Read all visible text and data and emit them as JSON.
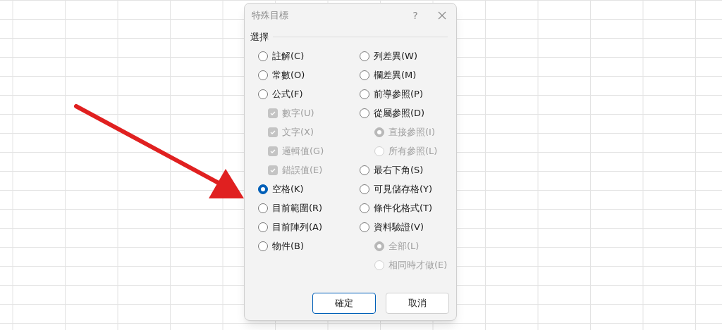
{
  "dialog": {
    "title": "特殊目標",
    "help": "?",
    "group_label": "選擇",
    "columns": [
      [
        {
          "kind": "radio",
          "label": "註解(C)",
          "selected": false,
          "disabled": false
        },
        {
          "kind": "radio",
          "label": "常數(O)",
          "selected": false,
          "disabled": false
        },
        {
          "kind": "radio",
          "label": "公式(F)",
          "selected": false,
          "disabled": false,
          "children": [
            {
              "kind": "checkbox",
              "label": "數字(U)",
              "checked": true,
              "disabled": true
            },
            {
              "kind": "checkbox",
              "label": "文字(X)",
              "checked": true,
              "disabled": true
            },
            {
              "kind": "checkbox",
              "label": "邏輯值(G)",
              "checked": true,
              "disabled": true
            },
            {
              "kind": "checkbox",
              "label": "錯誤值(E)",
              "checked": true,
              "disabled": true
            }
          ]
        },
        {
          "kind": "radio",
          "label": "空格(K)",
          "selected": true,
          "disabled": false
        },
        {
          "kind": "radio",
          "label": "目前範圍(R)",
          "selected": false,
          "disabled": false
        },
        {
          "kind": "radio",
          "label": "目前陣列(A)",
          "selected": false,
          "disabled": false
        },
        {
          "kind": "radio",
          "label": "物件(B)",
          "selected": false,
          "disabled": false
        }
      ],
      [
        {
          "kind": "radio",
          "label": "列差異(W)",
          "selected": false,
          "disabled": false
        },
        {
          "kind": "radio",
          "label": "欄差異(M)",
          "selected": false,
          "disabled": false
        },
        {
          "kind": "radio",
          "label": "前導參照(P)",
          "selected": false,
          "disabled": false
        },
        {
          "kind": "radio",
          "label": "從屬參照(D)",
          "selected": false,
          "disabled": false,
          "children": [
            {
              "kind": "radio",
              "label": "直接參照(I)",
              "selected": true,
              "disabled": true
            },
            {
              "kind": "radio",
              "label": "所有參照(L)",
              "selected": false,
              "disabled": true
            }
          ]
        },
        {
          "kind": "radio",
          "label": "最右下角(S)",
          "selected": false,
          "disabled": false
        },
        {
          "kind": "radio",
          "label": "可見儲存格(Y)",
          "selected": false,
          "disabled": false
        },
        {
          "kind": "radio",
          "label": "條件化格式(T)",
          "selected": false,
          "disabled": false
        },
        {
          "kind": "radio",
          "label": "資料驗證(V)",
          "selected": false,
          "disabled": false,
          "children": [
            {
              "kind": "radio",
              "label": "全部(L)",
              "selected": true,
              "disabled": true
            },
            {
              "kind": "radio",
              "label": "相同時才做(E)",
              "selected": false,
              "disabled": true
            }
          ]
        }
      ]
    ],
    "buttons": [
      {
        "label": "確定",
        "default": true
      },
      {
        "label": "取消",
        "default": false
      }
    ]
  }
}
